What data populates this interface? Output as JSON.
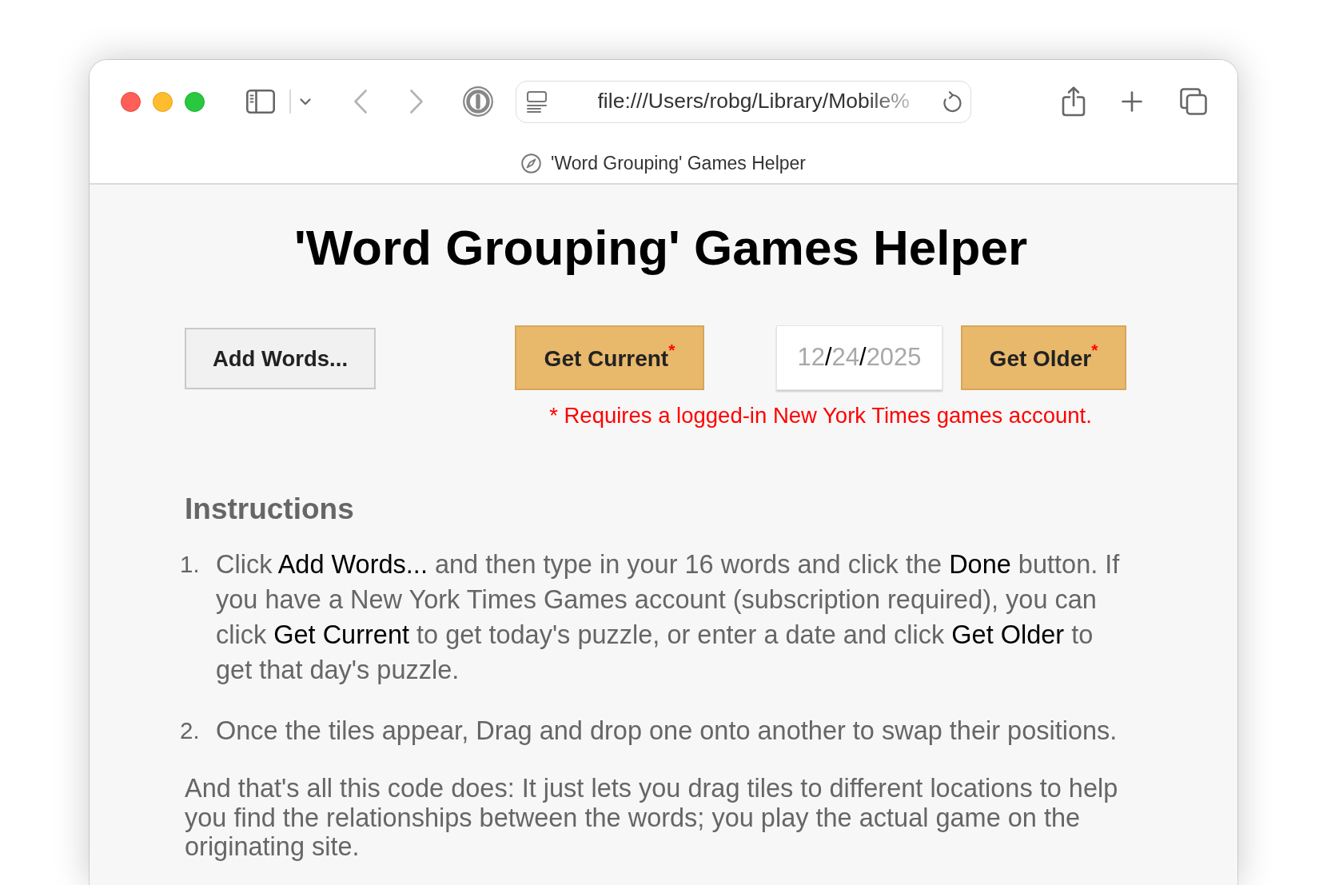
{
  "browser": {
    "address_bar": {
      "url": "file:///Users/robg/Library/Mobile%"
    },
    "tab_title": "'Word Grouping' Games Helper"
  },
  "page": {
    "title": "'Word Grouping' Games Helper",
    "add_words_button": {
      "label": "Add Words..."
    },
    "fetch_group": {
      "get_current_button": {
        "label": "Get Current$^{*}$"
      },
      "date_field": {
        "parts": [
          {
            "kind": "digits",
            "text": "12"
          },
          {
            "kind": "separator",
            "text": "/"
          },
          {
            "kind": "digits",
            "text": "24"
          },
          {
            "kind": "separator",
            "text": "/"
          },
          {
            "kind": "digits",
            "text": "2025"
          }
        ]
      },
      "get_older_button": {
        "label": "Get Older$^{*}$"
      },
      "note": "* Requires a logged-in New York Times games account."
    },
    "instructions": {
      "heading": "Instructions",
      "steps": [
        {
          "number": "1.",
          "text": "Click **Add Words...** and then type in your 16 words and click the **Done** button. If you have a New York Times Games account (subscription required), you can click **Get Current** to get today's puzzle, or enter a date and click **Get Older** to get that day's puzzle."
        },
        {
          "number": "2.",
          "text": "Once the tiles appear, Drag and drop one onto another to swap their positions."
        }
      ],
      "closing": "And that's all this code does: It just lets you drag tiles to different locations to help you find the relationships between the words; you play the actual game on the originating site."
    }
  }
}
